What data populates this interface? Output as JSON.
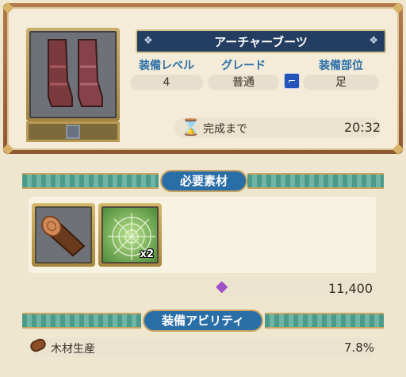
{
  "item": {
    "name": "アーチャーブーツ",
    "icon": "boots-icon",
    "stats": [
      {
        "label": "装備レベル",
        "value": "4"
      },
      {
        "label": "グレード",
        "value": "普通"
      },
      {
        "label": "装備部位",
        "value": "足",
        "icon": "boot-slot-icon"
      }
    ],
    "timer": {
      "label": "完成まで",
      "value": "20:32",
      "icon": "hourglass-icon"
    }
  },
  "materials_section": {
    "title": "必要素材",
    "items": [
      {
        "name": "log",
        "icon": "log-icon",
        "count": ""
      },
      {
        "name": "spider-web",
        "icon": "spider-web-icon",
        "count": "x2"
      }
    ],
    "cost": {
      "icon": "crystal-icon",
      "value": "11,400"
    }
  },
  "ability_section": {
    "title": "装備アビリティ",
    "abilities": [
      {
        "name": "木材生産",
        "value": "7.8%",
        "icon": "wood-icon"
      }
    ]
  },
  "colors": {
    "title_bar": "#233e60",
    "stat_label": "#2a6ea8",
    "section_title": "#2a6ea8",
    "wing_teal": "#4c9a8a",
    "frame_gold": "#c8a460",
    "panel_border": "#8e5a33"
  }
}
